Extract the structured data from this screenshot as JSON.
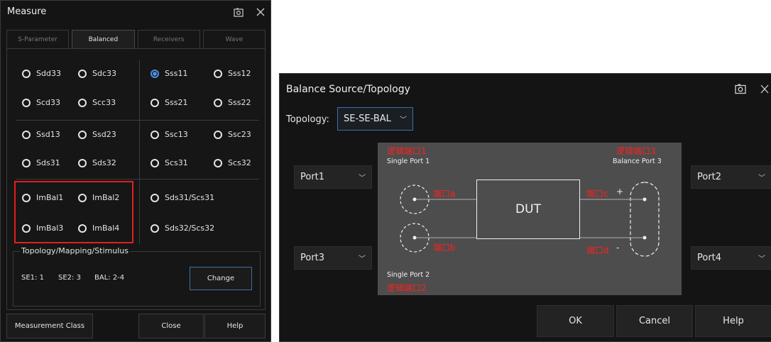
{
  "measure": {
    "title": "Measure",
    "tabs": [
      "S-Parameter",
      "Balanced",
      "Receivers",
      "Wave"
    ],
    "radios": {
      "sdd33": "Sdd33",
      "sdc33": "Sdc33",
      "scd33": "Scd33",
      "scc33": "Scc33",
      "sss11": "Sss11",
      "sss12": "Sss12",
      "sss21": "Sss21",
      "sss22": "Sss22",
      "ssd13": "Ssd13",
      "ssd23": "Ssd23",
      "sds31": "Sds31",
      "sds32": "Sds32",
      "ssc13": "Ssc13",
      "ssc23": "Ssc23",
      "scs31": "Scs31",
      "scs32": "Scs32",
      "imbal1": "ImBal1",
      "imbal2": "ImBal2",
      "imbal3": "ImBal3",
      "imbal4": "ImBal4",
      "sds31_scs31": "Sds31/Scs31",
      "sds32_scs32": "Sds32/Scs32"
    },
    "selected": "Sss11",
    "group_title": "Topology/Mapping/Stimulus",
    "se1": "SE1: 1",
    "se2": "SE2: 3",
    "bal": "BAL: 2-4",
    "change_label": "Change",
    "measurement_class_label": "Measurement Class",
    "close_label": "Close",
    "help_label": "Help"
  },
  "balance": {
    "title": "Balance Source/Topology",
    "topology_label": "Topology:",
    "topology_value": "SE-SE-BAL",
    "port1": "Port1",
    "port2": "Port2",
    "port3": "Port3",
    "port4": "Port4",
    "diagram": {
      "logical_port1": "逻辑端口1",
      "single_port1": "Single Port 1",
      "logical_port3": "逻辑端口3",
      "balance_port3": "Balance Port 3",
      "single_port2": "Single Port 2",
      "logical_port2": "逻辑端口2",
      "port_a": "端口a",
      "port_b": "端口b",
      "port_c": "端口c",
      "port_d": "端口d",
      "plus": "+",
      "minus": "-",
      "dut": "DUT"
    },
    "ok_label": "OK",
    "cancel_label": "Cancel",
    "help_label": "Help"
  },
  "colors": {
    "window_bg": "#141414",
    "accent_blue": "#3c6ea8",
    "highlight_red": "#e02020",
    "diagram_bg": "#4d4d4d"
  }
}
